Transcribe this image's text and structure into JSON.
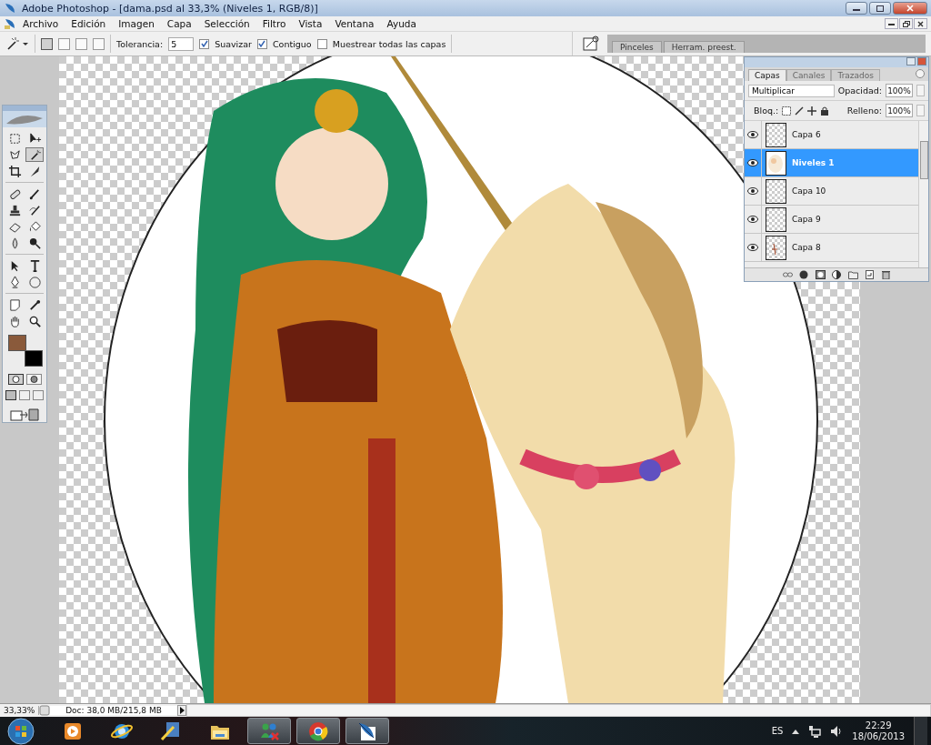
{
  "window": {
    "title": "Adobe Photoshop - [dama.psd al 33,3% (Niveles 1, RGB/8)]"
  },
  "menu": [
    "Archivo",
    "Edición",
    "Imagen",
    "Capa",
    "Selección",
    "Filtro",
    "Vista",
    "Ventana",
    "Ayuda"
  ],
  "options_bar": {
    "selection_modes": [
      {
        "selected": true
      },
      {
        "selected": false
      },
      {
        "selected": false
      },
      {
        "selected": false
      }
    ],
    "tolerance_label": "Tolerancia:",
    "tolerance": "5",
    "checkboxes": [
      {
        "label": "Suavizar",
        "checked": true
      },
      {
        "label": "Contiguo",
        "checked": true
      },
      {
        "label": "Muestrear todas las capas",
        "checked": false
      }
    ]
  },
  "palette_well": {
    "tabs": [
      "Pinceles",
      "Herram. preest."
    ]
  },
  "toolbox": {
    "tools": [
      {
        "kind": "marquee",
        "selected": false
      },
      {
        "kind": "move",
        "selected": false
      },
      {
        "kind": "lasso",
        "selected": false
      },
      {
        "kind": "wand",
        "selected": true
      },
      {
        "kind": "crop",
        "selected": false
      },
      {
        "kind": "slice",
        "selected": false
      },
      {
        "kind": "bandage",
        "selected": false
      },
      {
        "kind": "brush",
        "selected": false
      },
      {
        "kind": "stamp",
        "selected": false
      },
      {
        "kind": "history",
        "selected": false
      },
      {
        "kind": "eraser",
        "selected": false
      },
      {
        "kind": "bucket",
        "selected": false
      },
      {
        "kind": "drop",
        "selected": false
      },
      {
        "kind": "dodge",
        "selected": false
      },
      {
        "kind": "arrow",
        "selected": false
      },
      {
        "kind": "type",
        "selected": false
      },
      {
        "kind": "pen",
        "selected": false
      },
      {
        "kind": "ellipse",
        "selected": false
      },
      {
        "kind": "notes",
        "selected": false
      },
      {
        "kind": "eyedropper",
        "selected": false
      },
      {
        "kind": "hand",
        "selected": false
      },
      {
        "kind": "zoom",
        "selected": false
      }
    ],
    "swatches": [
      {
        "kind": "foreground",
        "color": "#8a5a3b"
      },
      {
        "kind": "background",
        "color": "#000000"
      }
    ],
    "mask_modes": [
      {
        "selected": true
      },
      {
        "selected": false
      }
    ],
    "screen_modes": [
      {
        "selected": true
      },
      {
        "selected": false
      },
      {
        "selected": false
      }
    ]
  },
  "layers_panel": {
    "tabs": [
      {
        "label": "Capas",
        "selected": true
      },
      {
        "label": "Canales",
        "selected": false
      },
      {
        "label": "Trazados",
        "selected": false
      }
    ],
    "blend_mode": "Multiplicar",
    "opacity_label": "Opacidad:",
    "opacity": "100%",
    "lock_label": "Bloq.:",
    "fill_label": "Relleno:",
    "fill": "100%",
    "layers": [
      {
        "name": "Capa 6",
        "visible": true,
        "selected": false,
        "kind": "empty"
      },
      {
        "name": "Niveles 1",
        "visible": true,
        "selected": true
      },
      {
        "name": "Capa 10",
        "visible": true,
        "selected": false,
        "kind": "empty"
      },
      {
        "name": "Capa 9",
        "visible": true,
        "selected": false,
        "kind": "empty"
      },
      {
        "name": "Capa 8",
        "visible": true,
        "selected": false,
        "kind": "sketch"
      }
    ]
  },
  "status_bar": {
    "zoom": "33,33%",
    "doc": "Doc: 38,0 MB/215,8 MB"
  },
  "taskbar": {
    "apps": [
      {
        "kind": "media",
        "running": false
      },
      {
        "kind": "ie",
        "running": false
      },
      {
        "kind": "tablet",
        "running": false
      },
      {
        "kind": "folder",
        "running": false
      },
      {
        "kind": "messenger",
        "running": true
      },
      {
        "kind": "chrome",
        "running": true
      },
      {
        "kind": "feather",
        "running": true
      }
    ],
    "language": "ES",
    "time": "22:29",
    "date": "18/06/2013"
  }
}
